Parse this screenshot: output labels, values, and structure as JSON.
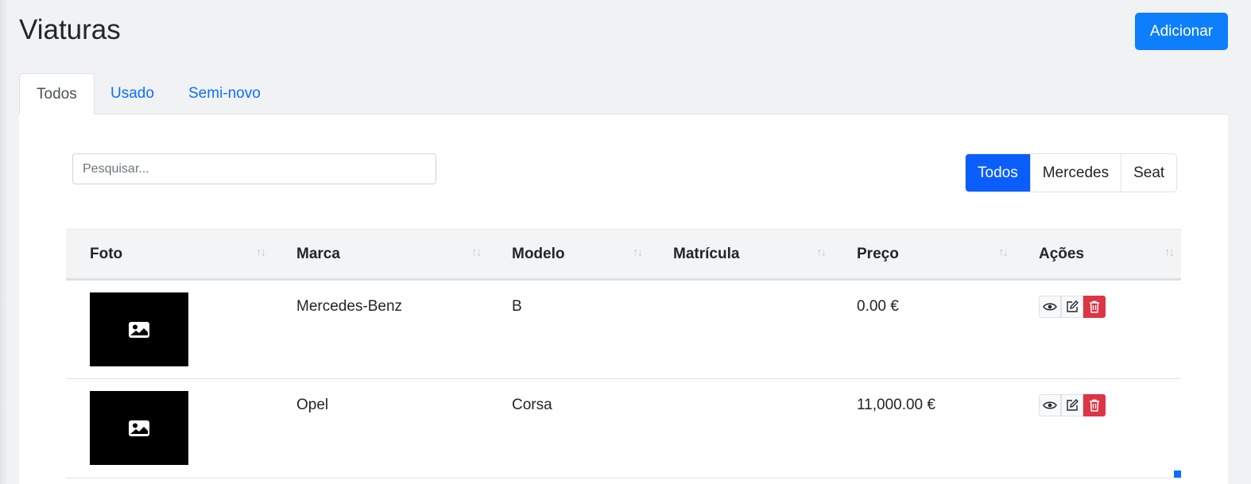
{
  "page": {
    "title": "Viaturas",
    "add_label": "Adicionar"
  },
  "tabs": [
    {
      "label": "Todos",
      "active": true
    },
    {
      "label": "Usado",
      "active": false
    },
    {
      "label": "Semi-novo",
      "active": false
    }
  ],
  "search": {
    "placeholder": "Pesquisar..."
  },
  "brand_filter": [
    {
      "label": "Todos",
      "active": true
    },
    {
      "label": "Mercedes",
      "active": false
    },
    {
      "label": "Seat",
      "active": false
    }
  ],
  "table": {
    "columns": [
      "Foto",
      "Marca",
      "Modelo",
      "Matrícula",
      "Preço",
      "Ações"
    ],
    "rows": [
      {
        "marca": "Mercedes-Benz",
        "modelo": "B",
        "matricula": "",
        "preco": "0.00 €"
      },
      {
        "marca": "Opel",
        "modelo": "Corsa",
        "matricula": "",
        "preco": "11,000.00 €"
      }
    ]
  },
  "icons": {
    "sort": "sort-arrows-icon",
    "photo": "image-placeholder-icon",
    "view": "eye-icon",
    "edit": "edit-icon",
    "delete": "trash-icon"
  },
  "colors": {
    "primary": "#0d7ffd",
    "danger": "#dc3545"
  }
}
